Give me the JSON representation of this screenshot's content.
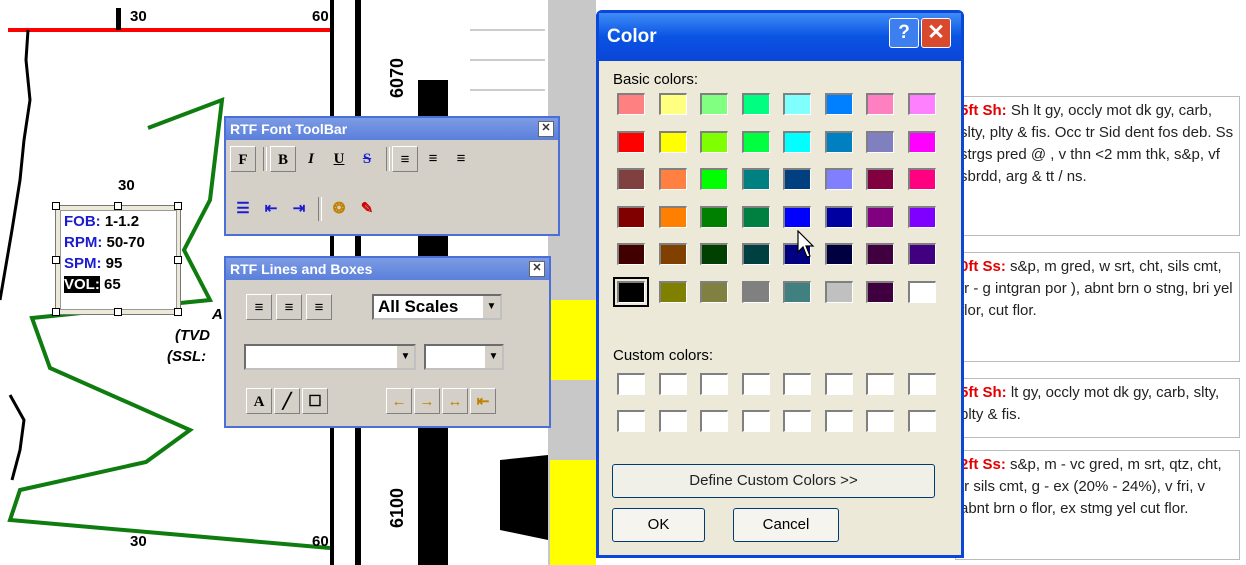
{
  "log_background": {
    "scale_labels": [
      "30",
      "60",
      "30",
      "30",
      "60"
    ],
    "depth_labels": [
      "6070",
      "6100"
    ],
    "drilling_params": [
      {
        "key": "FOB:",
        "value": "1-1.2"
      },
      {
        "key": "RPM:",
        "value": "50-70"
      },
      {
        "key": "SPM:",
        "value": "95"
      },
      {
        "key": "VOL:",
        "value": "65"
      }
    ],
    "partial_labels": [
      "A",
      "(TVD",
      "(SSL:"
    ],
    "lithology_notes": [
      {
        "head": "5ft Sh:",
        "text": " Sh lt gy, occly mot dk gy, carb, slty, plty & fis. Occ tr Sid dent fos deb. Ss strgs pred @ , v thn <2 mm thk, s&p, vf sbrdd, arg & tt / ns."
      },
      {
        "head": "0ft Ss:",
        "text": " s&p, m gred, w srt, cht, sils cmt, fr - g intgran por ), abnt brn o stng, bri yel flor, cut flor."
      },
      {
        "head": "5ft Sh:",
        "text": " lt gy, occly mot dk gy, carb, slty, plty & fis."
      },
      {
        "head": "2ft Ss:",
        "text": " s&p, m - vc gred, m srt, qtz, cht, tr sils cmt, g - ex (20% - 24%), v fri, v abnt brn o flor, ex stmg yel cut flor."
      }
    ]
  },
  "font_toolbar": {
    "title": "RTF Font ToolBar",
    "buttons": [
      "F",
      "B",
      "I",
      "U",
      "S"
    ]
  },
  "lines_toolbar": {
    "title": "RTF Lines and Boxes",
    "scale_select": "All Scales",
    "text_button": "A"
  },
  "color_dialog": {
    "title": "Color",
    "help_label": "?",
    "close_label": "✕",
    "basic_colors_label": "Basic colors:",
    "custom_colors_label": "Custom colors:",
    "define_custom_button": "Define Custom Colors >>",
    "ok_button": "OK",
    "cancel_button": "Cancel",
    "selected_color": "#000000",
    "basic_colors": [
      [
        "#ff8080",
        "#ffff80",
        "#80ff80",
        "#00ff80",
        "#80ffff",
        "#0080ff",
        "#ff80c0",
        "#ff80ff"
      ],
      [
        "#ff0000",
        "#ffff00",
        "#80ff00",
        "#00ff40",
        "#00ffff",
        "#0080c0",
        "#8080c0",
        "#ff00ff"
      ],
      [
        "#804040",
        "#ff8040",
        "#00ff00",
        "#008080",
        "#004080",
        "#8080ff",
        "#800040",
        "#ff0080"
      ],
      [
        "#800000",
        "#ff8000",
        "#008000",
        "#008040",
        "#0000ff",
        "#0000a0",
        "#800080",
        "#8000ff"
      ],
      [
        "#400000",
        "#804000",
        "#004000",
        "#004040",
        "#000080",
        "#000040",
        "#400040",
        "#400080"
      ],
      [
        "#000000",
        "#808000",
        "#808040",
        "#808080",
        "#408080",
        "#c0c0c0",
        "#400040",
        "#ffffff"
      ]
    ],
    "custom_colors": [
      [
        "#ffffff",
        "#ffffff",
        "#ffffff",
        "#ffffff",
        "#ffffff",
        "#ffffff",
        "#ffffff",
        "#ffffff"
      ],
      [
        "#ffffff",
        "#ffffff",
        "#ffffff",
        "#ffffff",
        "#ffffff",
        "#ffffff",
        "#ffffff",
        "#ffffff"
      ]
    ]
  }
}
